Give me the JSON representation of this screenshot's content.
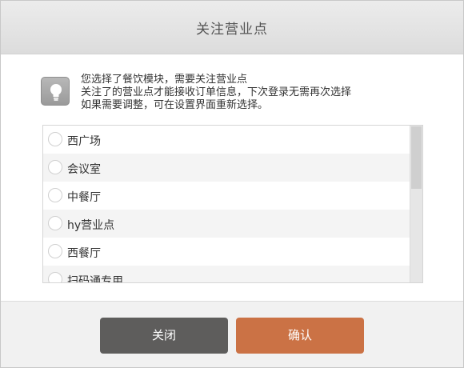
{
  "dialog": {
    "title": "关注营业点"
  },
  "tip": {
    "icon": "lightbulb-icon",
    "lines": [
      "您选择了餐饮模块，需要关注营业点",
      "关注了的营业点才能接收订单信息，下次登录无需再次选择",
      "如果需要调整，可在设置界面重新选择。"
    ]
  },
  "locations": [
    {
      "label": "西广场",
      "selected": false
    },
    {
      "label": "会议室",
      "selected": false
    },
    {
      "label": "中餐厅",
      "selected": false
    },
    {
      "label": "hy营业点",
      "selected": false
    },
    {
      "label": "西餐厅",
      "selected": false
    },
    {
      "label": "扫码通专用",
      "selected": false
    }
  ],
  "buttons": {
    "close_label": "关闭",
    "confirm_label": "确认"
  },
  "colors": {
    "close_button": "#5e5d5c",
    "confirm_button": "#cb7245",
    "header": "#e0e0e0"
  }
}
